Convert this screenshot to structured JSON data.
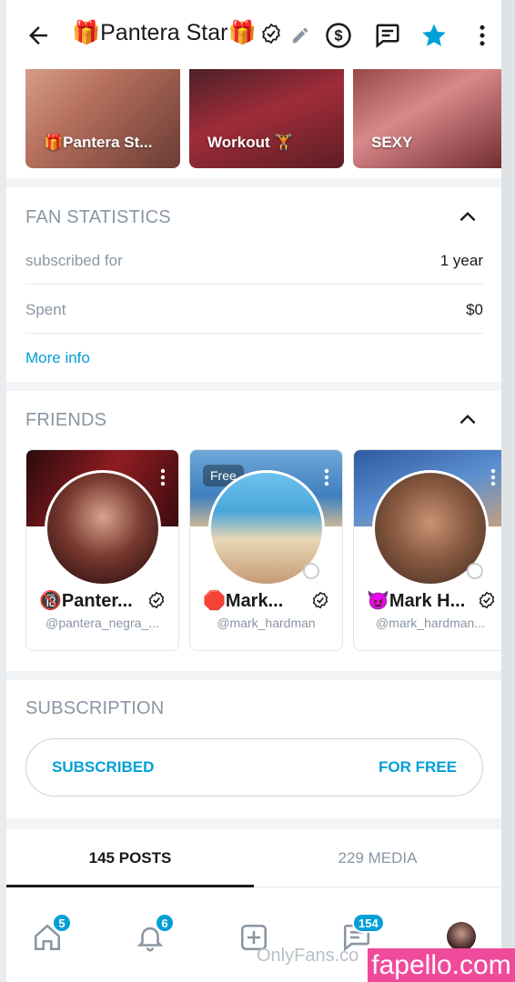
{
  "header": {
    "title": "🎁Pantera Star🎁",
    "icons": [
      "back-arrow-icon",
      "verified-icon",
      "pencil-icon",
      "dollar-icon",
      "message-icon",
      "star-icon",
      "more-icon"
    ]
  },
  "highlights": [
    {
      "label": "🎁Pantera St..."
    },
    {
      "label": "Workout 🏋️"
    },
    {
      "label": "SEXY"
    }
  ],
  "fan_statistics": {
    "title": "FAN STATISTICS",
    "rows": [
      {
        "label": "subscribed for",
        "value": "1 year"
      },
      {
        "label": "Spent",
        "value": "$0"
      }
    ],
    "more_info": "More info"
  },
  "friends": {
    "title": "FRIENDS",
    "cards": [
      {
        "name": "🔞Panter...",
        "username": "@pantera_negra_...",
        "badge": ""
      },
      {
        "name": "🛑Mark...",
        "username": "@mark_hardman",
        "badge": "Free"
      },
      {
        "name": "😈Mark H...",
        "username": "@mark_hardman...",
        "badge": ""
      }
    ]
  },
  "subscription": {
    "title": "SUBSCRIPTION",
    "left": "SUBSCRIBED",
    "right": "FOR FREE"
  },
  "tabs": [
    {
      "label": "145 POSTS",
      "active": true
    },
    {
      "label": "229 MEDIA",
      "active": false
    }
  ],
  "bottom_nav": {
    "home_badge": "5",
    "notifications_badge": "6",
    "messages_badge": "154"
  },
  "watermark": "OnlyFans.co",
  "fapello": "fapello.com",
  "colors": {
    "accent": "#00a0d6",
    "muted": "#8a96a3",
    "fapello": "#f04a9b"
  }
}
